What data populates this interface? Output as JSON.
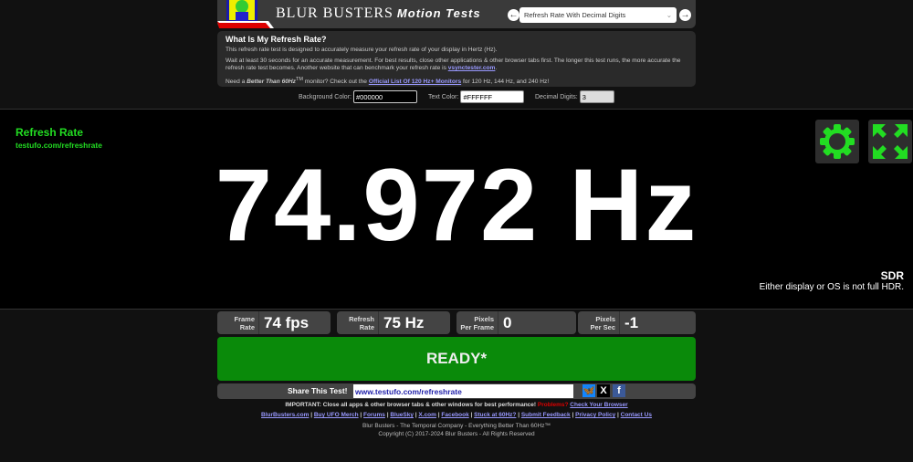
{
  "header": {
    "brand": "BLUR BUSTERS",
    "brand_suffix": "Motion Tests",
    "prev": "←",
    "next": "→",
    "selected_test": "Refresh Rate With Decimal Digits"
  },
  "info": {
    "title": "What Is My Refresh Rate?",
    "p1": "This refresh rate test is designed to accurately measure your refresh rate of your display in Hertz (Hz).",
    "p2": "Wait at least 30 seconds for an accurate measurement. For best results, close other applications & other browser tabs first. The longer this test runs, the more accurate the refresh rate test becomes. Another website that can benchmark your refresh rate is",
    "p2_link": "vsynctester.com",
    "p3_a": "Need a",
    "p3_b": "Better Than 60Hz",
    "p3_tm": "TM",
    "p3_c": "monitor? Check out the",
    "p3_link": "Official List Of 120 Hz+ Monitors",
    "p3_d": "for 120 Hz, 144 Hz, and 240 Hz!"
  },
  "options": {
    "bg_label": "Background Color:",
    "bg_value": "#000000",
    "text_label": "Text Color:",
    "text_value": "#FFFFFF",
    "digits_label": "Decimal Digits:",
    "digits_value": "3"
  },
  "side": {
    "title": "Refresh Rate",
    "url": "testufo.com/refreshrate"
  },
  "measurement": "74.972 Hz",
  "hdr": {
    "title": "SDR",
    "note": "Either display or OS is not full HDR."
  },
  "stats": [
    {
      "label1": "Frame",
      "label2": "Rate",
      "value": "74 fps"
    },
    {
      "label1": "Refresh",
      "label2": "Rate",
      "value": "75 Hz"
    },
    {
      "label1": "Pixels",
      "label2": "Per Frame",
      "value": "0"
    },
    {
      "label1": "Pixels",
      "label2": "Per Sec",
      "value": "-1"
    }
  ],
  "ready": "READY*",
  "share": {
    "label": "Share This Test!",
    "url": "www.testufo.com/refreshrate",
    "bluesky": "🦋",
    "x": "X",
    "facebook": "f"
  },
  "important": {
    "text": "IMPORTANT: Close all apps & other browser tabs & other windows for best performance!",
    "problems": "Problems?",
    "check": "Check Your Browser"
  },
  "links": [
    "BlurBusters.com",
    "Buy UFO Merch",
    "Forums",
    "BlueSky",
    "X.com",
    "Facebook",
    "Stuck at 60Hz?",
    "Submit Feedback",
    "Privacy Policy",
    "Contact Us"
  ],
  "footer": {
    "line1": "Blur Busters - The Temporal Company - Everything Better Than 60Hz™",
    "line2": "Copyright (C) 2017-2024 Blur Busters - All Rights Reserved"
  },
  "colors": {
    "accent": "#22dd22",
    "ready": "#0a8a0a"
  }
}
